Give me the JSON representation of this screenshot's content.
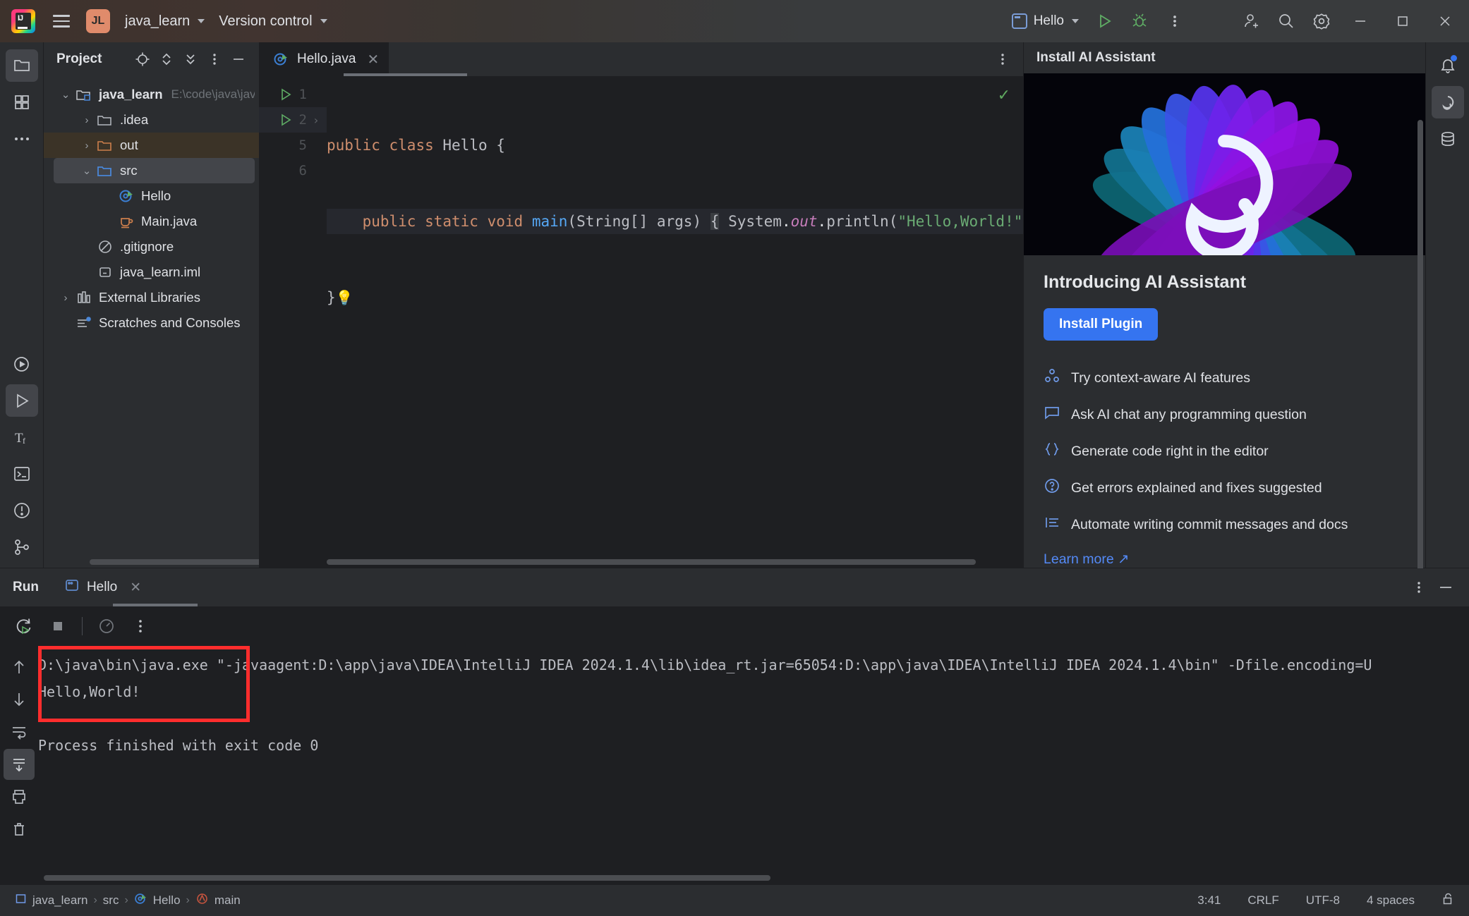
{
  "titlebar": {
    "menu_icon": "hamburger-icon",
    "project_initials": "JL",
    "project_name": "java_learn",
    "version_control": "Version control",
    "run_config": "Hello",
    "run_icon": "run-icon",
    "debug_icon": "debug-icon",
    "more_icon": "more-vertical-icon",
    "add_user_icon": "add-user-icon",
    "search_icon": "search-icon",
    "settings_icon": "gear-icon",
    "minimize": "minimize-icon",
    "maximize": "maximize-icon",
    "close": "close-icon"
  },
  "left_rail": [
    {
      "name": "project-tool-window",
      "icon": "folder-icon",
      "active": true
    },
    {
      "name": "structure-tool-window",
      "icon": "structure-icon",
      "active": false
    },
    {
      "name": "more-tool-windows",
      "icon": "ellipsis-icon",
      "active": false
    },
    {
      "name": "run-tool-window",
      "icon": "run-circle-icon",
      "active": false
    },
    {
      "name": "debug-tool-window",
      "icon": "run-play-icon",
      "active": true
    },
    {
      "name": "translate-tool-window",
      "icon": "translate-icon",
      "active": false
    },
    {
      "name": "terminal-tool-window",
      "icon": "terminal-icon",
      "active": false
    },
    {
      "name": "problems-tool-window",
      "icon": "warning-circle-icon",
      "active": false
    },
    {
      "name": "version-control-tool-window",
      "icon": "branch-icon",
      "active": false
    }
  ],
  "project_panel": {
    "title": "Project",
    "header_icons": [
      "locate-icon",
      "expand-collapse-icon",
      "collapse-all-icon",
      "options-icon",
      "hide-icon"
    ],
    "tree": [
      {
        "label": "java_learn",
        "path": "E:\\code\\java\\jav",
        "icon": "module-folder-icon",
        "indent": 0,
        "arrow": "down",
        "bold": true,
        "state": "none"
      },
      {
        "label": ".idea",
        "path": "",
        "icon": "folder-icon",
        "indent": 1,
        "arrow": "right",
        "bold": false,
        "state": "none"
      },
      {
        "label": "out",
        "path": "",
        "icon": "folder-orange-icon",
        "indent": 1,
        "arrow": "right",
        "bold": false,
        "state": "out"
      },
      {
        "label": "src",
        "path": "",
        "icon": "folder-blue-icon",
        "indent": 1,
        "arrow": "down",
        "bold": false,
        "state": "selected"
      },
      {
        "label": "Hello",
        "path": "",
        "icon": "java-class-run-icon",
        "indent": 2,
        "arrow": "",
        "bold": false,
        "state": "none"
      },
      {
        "label": "Main.java",
        "path": "",
        "icon": "java-file-icon",
        "indent": 2,
        "arrow": "",
        "bold": false,
        "state": "none"
      },
      {
        "label": ".gitignore",
        "path": "",
        "icon": "gitignore-icon",
        "indent": 1,
        "arrow": "",
        "bold": false,
        "state": "none"
      },
      {
        "label": "java_learn.iml",
        "path": "",
        "icon": "iml-file-icon",
        "indent": 1,
        "arrow": "",
        "bold": false,
        "state": "none"
      },
      {
        "label": "External Libraries",
        "path": "",
        "icon": "library-icon",
        "indent": 0,
        "arrow": "right",
        "bold": false,
        "state": "none"
      },
      {
        "label": "Scratches and Consoles",
        "path": "",
        "icon": "scratches-icon",
        "indent": 0,
        "arrow": "",
        "bold": false,
        "state": "none"
      }
    ]
  },
  "editor": {
    "tab_label": "Hello.java",
    "tab_icon": "java-class-run-icon",
    "close_icon": "close-icon",
    "options_icon": "more-vertical-icon",
    "inspection_status": "✓",
    "lines": [
      {
        "num": "1",
        "gutter_run": true,
        "gutter_fold": "",
        "cur": false
      },
      {
        "num": "2",
        "gutter_run": true,
        "gutter_fold": "›",
        "cur": true
      },
      {
        "num": "5",
        "gutter_run": false,
        "gutter_fold": "",
        "cur": false
      },
      {
        "num": "6",
        "gutter_run": false,
        "gutter_fold": "",
        "cur": false
      }
    ],
    "code": {
      "line1": "public class Hello {",
      "line2": "    public static void main(String[] args) { System.out.println(\"Hello,World!\"); }",
      "line3": "}"
    }
  },
  "ai_panel": {
    "header": "Install AI Assistant",
    "heading": "Introducing AI Assistant",
    "install_button": "Install Plugin",
    "features": [
      {
        "icon": "ai-sparkle-icon",
        "text": "Try context-aware AI features"
      },
      {
        "icon": "chat-bubble-icon",
        "text": "Ask AI chat any programming question"
      },
      {
        "icon": "braces-icon",
        "text": "Generate code right in the editor"
      },
      {
        "icon": "question-circle-icon",
        "text": "Get errors explained and fixes suggested"
      },
      {
        "icon": "commit-lines-icon",
        "text": "Automate writing commit messages and docs"
      }
    ],
    "learn_more": "Learn more ↗"
  },
  "right_rail": [
    {
      "name": "notifications-tool-window",
      "icon": "bell-icon"
    },
    {
      "name": "ai-assistant-tool-window",
      "icon": "ai-icon"
    },
    {
      "name": "database-tool-window",
      "icon": "database-icon"
    }
  ],
  "run_panel": {
    "title": "Run",
    "tab_label": "Hello",
    "tab_icon": "run-config-icon",
    "tab_close": "close-icon",
    "options_icon": "more-vertical-icon",
    "hide_icon": "minimize-icon",
    "toolbar": [
      {
        "name": "rerun-button",
        "icon": "rerun-icon"
      },
      {
        "name": "stop-button",
        "icon": "stop-icon"
      },
      {
        "name": "profiler-button",
        "icon": "gauge-icon"
      },
      {
        "name": "more-button",
        "icon": "more-vertical-icon"
      }
    ],
    "side_tools": [
      {
        "name": "scroll-up-button",
        "icon": "arrow-up-icon"
      },
      {
        "name": "scroll-down-button",
        "icon": "arrow-down-icon"
      },
      {
        "name": "soft-wrap-button",
        "icon": "wrap-icon"
      },
      {
        "name": "scroll-to-end-button",
        "icon": "scroll-end-icon",
        "active": true
      },
      {
        "name": "print-button",
        "icon": "printer-icon"
      },
      {
        "name": "clear-all-button",
        "icon": "trash-icon"
      }
    ],
    "console": {
      "line1": "D:\\java\\bin\\java.exe \"-javaagent:D:\\app\\java\\IDEA\\IntelliJ IDEA 2024.1.4\\lib\\idea_rt.jar=65054:D:\\app\\java\\IDEA\\IntelliJ IDEA 2024.1.4\\bin\" -Dfile.encoding=U",
      "line2": "Hello,World!",
      "line3": "",
      "line4": "Process finished with exit code 0"
    },
    "annotation_color": "#ff2d2d"
  },
  "statusbar": {
    "breadcrumbs": [
      {
        "label": "java_learn",
        "icon": "module-icon"
      },
      {
        "label": "src",
        "icon": ""
      },
      {
        "label": "Hello",
        "icon": "java-class-run-icon"
      },
      {
        "label": "main",
        "icon": "method-icon"
      }
    ],
    "caret_position": "3:41",
    "line_separator": "CRLF",
    "encoding": "UTF-8",
    "indent": "4 spaces",
    "lock_icon": "unlocked-icon"
  },
  "colors": {
    "accent_blue": "#3574f0",
    "title_gradient_left": "#3d322c",
    "panel_bg": "#2b2d30",
    "editor_bg": "#1e1f22",
    "selection": "#43454a",
    "out_folder_highlight": "#3b3327",
    "keyword": "#cf8e6d",
    "string": "#6aab73",
    "method": "#56a8f5",
    "field_italic": "#c77dbb",
    "annotation_red": "#ff2d2d"
  }
}
